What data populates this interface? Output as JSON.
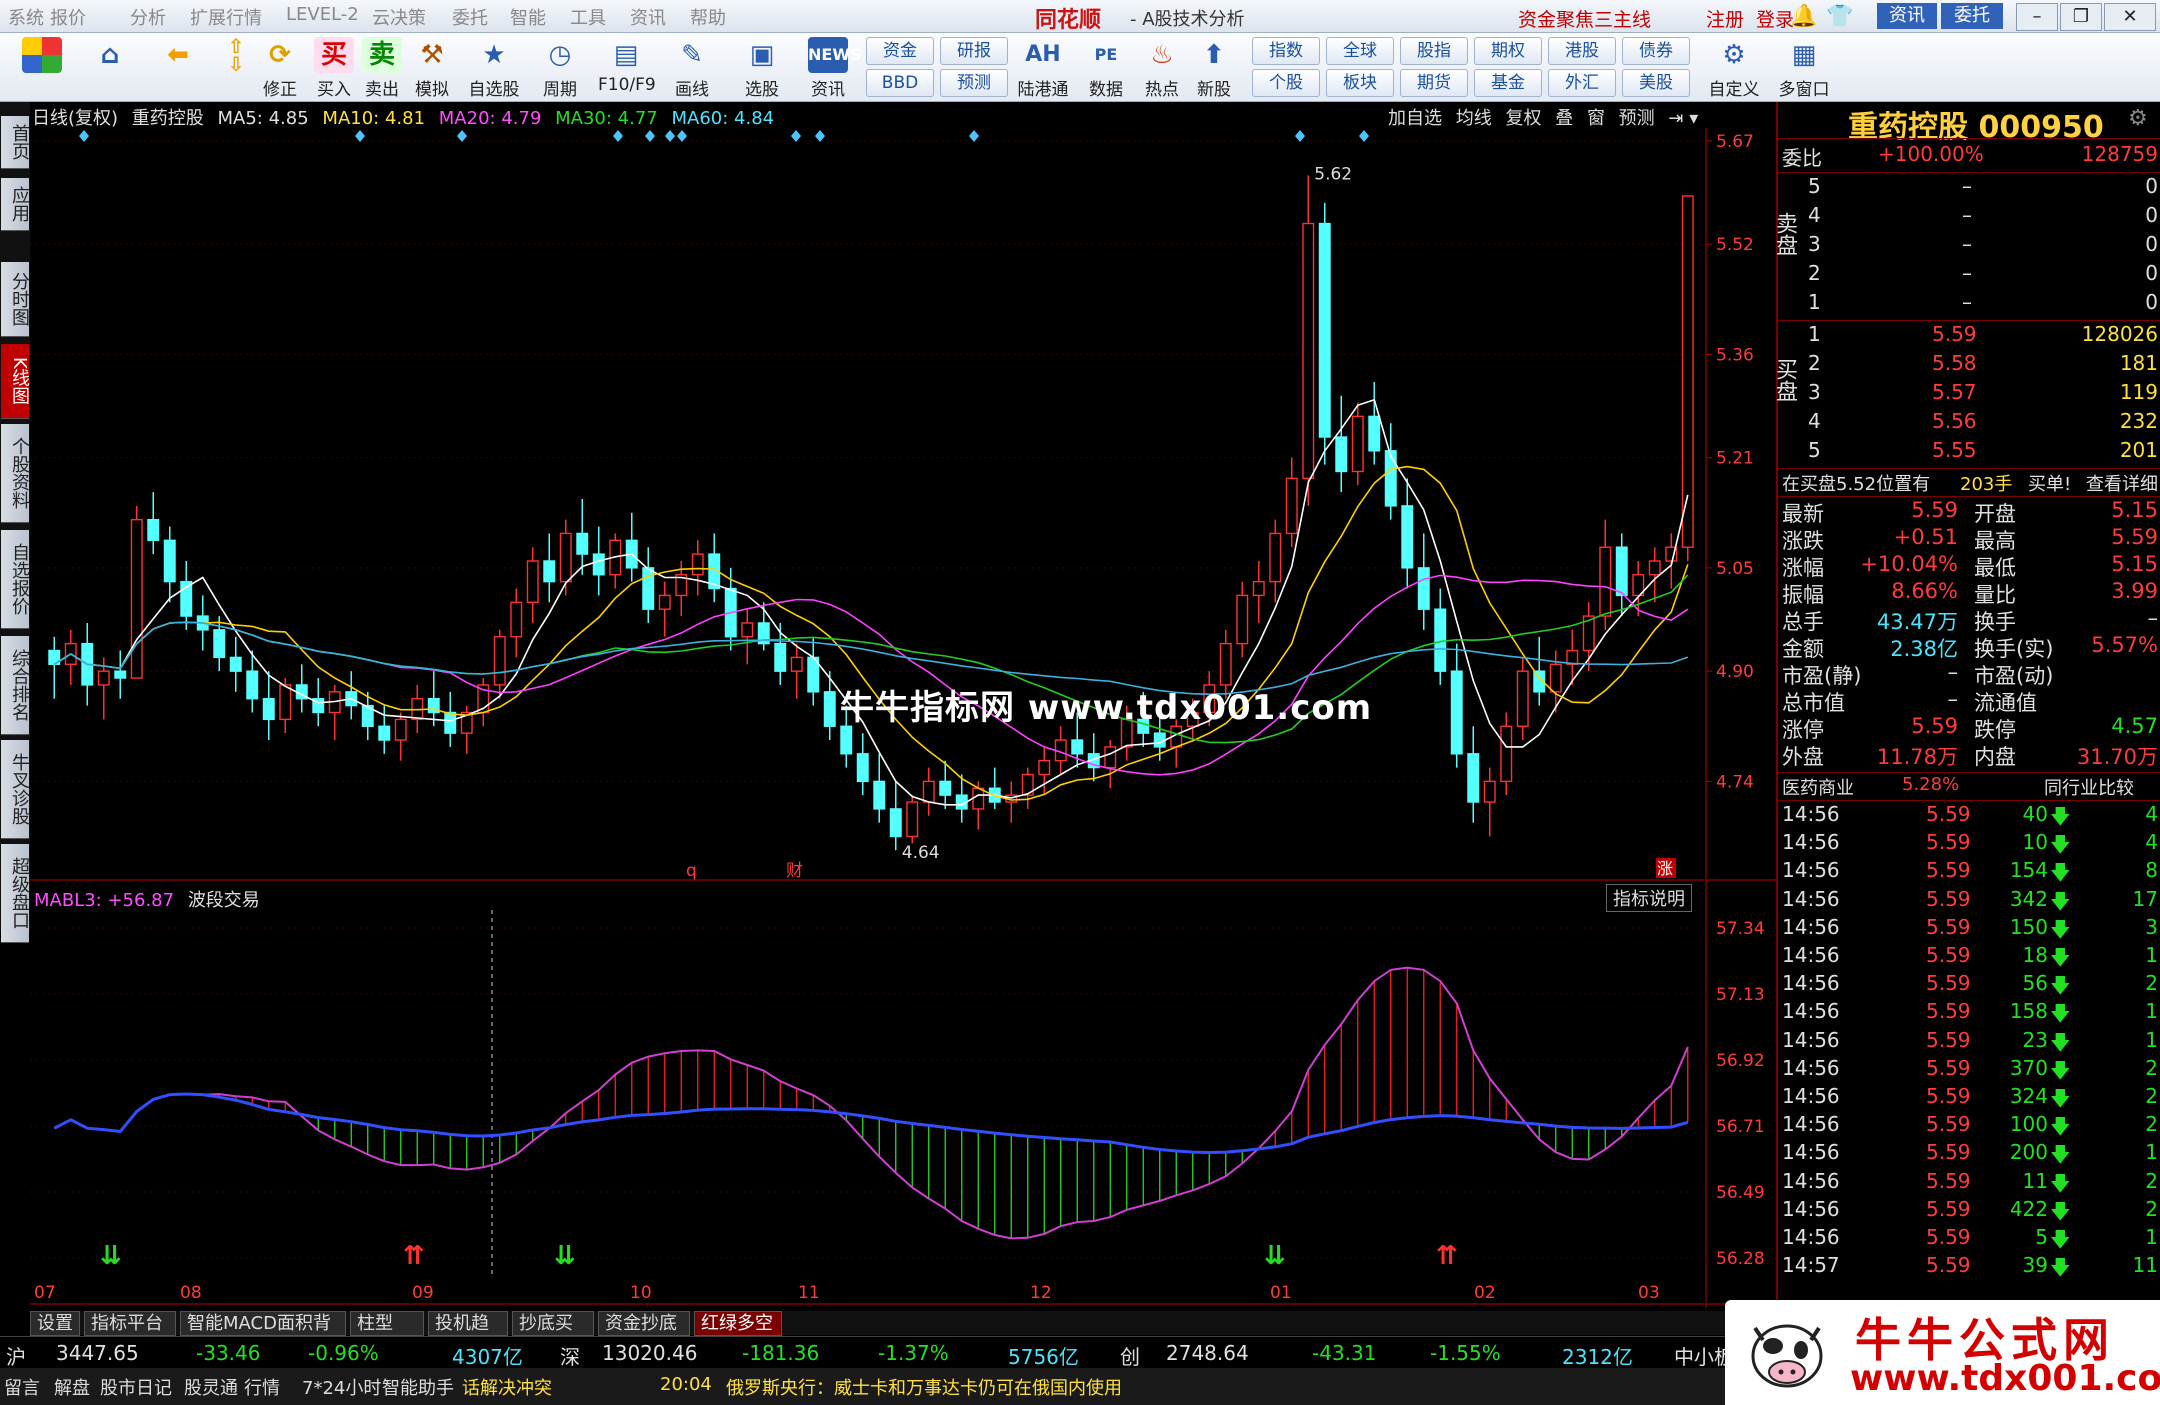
{
  "menu": [
    "系统",
    "报价",
    "分析",
    "扩展行情",
    "LEVEL-2",
    "云决策",
    "委托",
    "智能",
    "工具",
    "资讯",
    "帮助"
  ],
  "brand": "同花顺",
  "app_title": "- A股技术分析",
  "promo": "资金聚焦三主线",
  "register": "注册",
  "login": "登录",
  "news_btn": "资讯",
  "trade_btn": "委托",
  "toolbar": {
    "buttons": [
      "修正",
      "买入",
      "卖出",
      "模拟",
      "自选股",
      "周期",
      "F10/F9",
      "画线",
      "选股",
      "资讯",
      "陆港通",
      "数据",
      "热点",
      "新股",
      "自定义",
      "多窗口"
    ],
    "small": [
      "资金",
      "BBD",
      "研报",
      "预测",
      "指数",
      "个股",
      "全球",
      "板块",
      "股指",
      "期货",
      "期权",
      "基金",
      "港股",
      "外汇",
      "债券",
      "美股"
    ]
  },
  "left_tabs": [
    "首页",
    "应用",
    "分时图",
    "K线图",
    "个股资料",
    "自选报价",
    "综合排名",
    "牛叉诊股",
    "超级盘口"
  ],
  "chart_header": {
    "period": "日线(复权)",
    "name": "重药控股",
    "ma5": "MA5: 4.85",
    "ma10": "MA10: 4.81",
    "ma20": "MA20: 4.79",
    "ma30": "MA30: 4.77",
    "ma60": "MA60: 4.84",
    "tools": [
      "加自选",
      "均线",
      "复权",
      "叠",
      "窗",
      "预测"
    ]
  },
  "chart_data": {
    "type": "candlestick",
    "title": "重药控股 日线(复权)",
    "y_ticks": [
      "5.67",
      "5.52",
      "5.36",
      "5.21",
      "5.05",
      "4.90",
      "4.74"
    ],
    "ylim": [
      4.62,
      5.68
    ],
    "x_labels": [
      "07",
      "08",
      "09",
      "10",
      "11",
      "12",
      "01",
      "02",
      "03"
    ],
    "annotations": {
      "high": "5.62",
      "low": "4.64",
      "markers": [
        "q",
        "财",
        "涨"
      ]
    },
    "candles": [
      [
        4.93,
        4.95,
        4.86,
        4.91
      ],
      [
        4.91,
        4.96,
        4.88,
        4.94
      ],
      [
        4.94,
        4.97,
        4.85,
        4.88
      ],
      [
        4.88,
        4.92,
        4.83,
        4.9
      ],
      [
        4.9,
        4.93,
        4.86,
        4.89
      ],
      [
        4.89,
        5.14,
        4.89,
        5.12
      ],
      [
        5.12,
        5.16,
        5.07,
        5.09
      ],
      [
        5.09,
        5.11,
        5.0,
        5.03
      ],
      [
        5.03,
        5.06,
        4.96,
        4.98
      ],
      [
        4.98,
        5.01,
        4.93,
        4.96
      ],
      [
        4.96,
        4.98,
        4.9,
        4.92
      ],
      [
        4.92,
        4.95,
        4.87,
        4.9
      ],
      [
        4.9,
        4.93,
        4.84,
        4.86
      ],
      [
        4.86,
        4.9,
        4.8,
        4.83
      ],
      [
        4.83,
        4.89,
        4.81,
        4.88
      ],
      [
        4.88,
        4.91,
        4.84,
        4.86
      ],
      [
        4.86,
        4.89,
        4.82,
        4.84
      ],
      [
        4.84,
        4.88,
        4.8,
        4.87
      ],
      [
        4.87,
        4.9,
        4.83,
        4.85
      ],
      [
        4.85,
        4.87,
        4.8,
        4.82
      ],
      [
        4.82,
        4.85,
        4.78,
        4.8
      ],
      [
        4.8,
        4.84,
        4.77,
        4.83
      ],
      [
        4.83,
        4.88,
        4.81,
        4.86
      ],
      [
        4.86,
        4.9,
        4.82,
        4.84
      ],
      [
        4.84,
        4.87,
        4.79,
        4.81
      ],
      [
        4.81,
        4.85,
        4.78,
        4.84
      ],
      [
        4.84,
        4.89,
        4.82,
        4.88
      ],
      [
        4.88,
        4.96,
        4.86,
        4.95
      ],
      [
        4.95,
        5.02,
        4.92,
        5.0
      ],
      [
        5.0,
        5.08,
        4.97,
        5.06
      ],
      [
        5.06,
        5.1,
        5.0,
        5.03
      ],
      [
        5.03,
        5.12,
        5.01,
        5.1
      ],
      [
        5.1,
        5.15,
        5.04,
        5.07
      ],
      [
        5.07,
        5.11,
        5.01,
        5.04
      ],
      [
        5.04,
        5.1,
        5.02,
        5.09
      ],
      [
        5.09,
        5.13,
        5.03,
        5.05
      ],
      [
        5.05,
        5.08,
        4.97,
        4.99
      ],
      [
        4.99,
        5.03,
        4.95,
        5.01
      ],
      [
        5.01,
        5.06,
        4.98,
        5.04
      ],
      [
        5.04,
        5.09,
        5.01,
        5.07
      ],
      [
        5.07,
        5.1,
        5.0,
        5.02
      ],
      [
        5.02,
        5.05,
        4.93,
        4.95
      ],
      [
        4.95,
        4.99,
        4.91,
        4.97
      ],
      [
        4.97,
        5.0,
        4.93,
        4.94
      ],
      [
        4.94,
        4.97,
        4.88,
        4.9
      ],
      [
        4.9,
        4.94,
        4.86,
        4.92
      ],
      [
        4.92,
        4.95,
        4.85,
        4.87
      ],
      [
        4.87,
        4.9,
        4.8,
        4.82
      ],
      [
        4.82,
        4.85,
        4.76,
        4.78
      ],
      [
        4.78,
        4.81,
        4.72,
        4.74
      ],
      [
        4.74,
        4.78,
        4.68,
        4.7
      ],
      [
        4.7,
        4.74,
        4.64,
        4.66
      ],
      [
        4.66,
        4.72,
        4.65,
        4.71
      ],
      [
        4.71,
        4.76,
        4.69,
        4.74
      ],
      [
        4.74,
        4.77,
        4.7,
        4.72
      ],
      [
        4.72,
        4.75,
        4.68,
        4.7
      ],
      [
        4.7,
        4.74,
        4.67,
        4.73
      ],
      [
        4.73,
        4.76,
        4.7,
        4.71
      ],
      [
        4.71,
        4.74,
        4.68,
        4.72
      ],
      [
        4.72,
        4.76,
        4.7,
        4.75
      ],
      [
        4.75,
        4.79,
        4.72,
        4.77
      ],
      [
        4.77,
        4.82,
        4.75,
        4.8
      ],
      [
        4.8,
        4.84,
        4.76,
        4.78
      ],
      [
        4.78,
        4.81,
        4.74,
        4.76
      ],
      [
        4.76,
        4.8,
        4.73,
        4.79
      ],
      [
        4.79,
        4.85,
        4.77,
        4.83
      ],
      [
        4.83,
        4.87,
        4.79,
        4.81
      ],
      [
        4.81,
        4.84,
        4.77,
        4.79
      ],
      [
        4.79,
        4.83,
        4.76,
        4.82
      ],
      [
        4.82,
        4.86,
        4.8,
        4.84
      ],
      [
        4.84,
        4.9,
        4.82,
        4.88
      ],
      [
        4.88,
        4.96,
        4.86,
        4.94
      ],
      [
        4.94,
        5.03,
        4.92,
        5.01
      ],
      [
        5.01,
        5.06,
        4.97,
        5.03
      ],
      [
        5.03,
        5.12,
        5.0,
        5.1
      ],
      [
        5.1,
        5.21,
        5.08,
        5.18
      ],
      [
        5.18,
        5.62,
        5.14,
        5.55
      ],
      [
        5.55,
        5.58,
        5.2,
        5.24
      ],
      [
        5.24,
        5.3,
        5.16,
        5.19
      ],
      [
        5.19,
        5.29,
        5.17,
        5.27
      ],
      [
        5.27,
        5.32,
        5.2,
        5.22
      ],
      [
        5.22,
        5.26,
        5.12,
        5.14
      ],
      [
        5.14,
        5.18,
        5.02,
        5.05
      ],
      [
        5.05,
        5.1,
        4.96,
        4.99
      ],
      [
        4.99,
        5.02,
        4.88,
        4.9
      ],
      [
        4.9,
        4.94,
        4.76,
        4.78
      ],
      [
        4.78,
        4.82,
        4.68,
        4.71
      ],
      [
        4.71,
        4.76,
        4.66,
        4.74
      ],
      [
        4.74,
        4.84,
        4.72,
        4.82
      ],
      [
        4.82,
        4.92,
        4.8,
        4.9
      ],
      [
        4.9,
        4.95,
        4.85,
        4.87
      ],
      [
        4.87,
        4.93,
        4.84,
        4.91
      ],
      [
        4.91,
        4.96,
        4.88,
        4.93
      ],
      [
        4.93,
        5.0,
        4.9,
        4.98
      ],
      [
        4.98,
        5.12,
        4.96,
        5.08
      ],
      [
        5.08,
        5.1,
        4.98,
        5.01
      ],
      [
        5.01,
        5.06,
        4.98,
        5.04
      ],
      [
        5.04,
        5.08,
        5.0,
        5.06
      ],
      [
        5.06,
        5.1,
        5.02,
        5.08
      ],
      [
        5.08,
        5.59,
        5.06,
        5.59
      ]
    ],
    "ma_series": [
      {
        "name": "MA5",
        "color": "#ffffff"
      },
      {
        "name": "MA10",
        "color": "#ffd000"
      },
      {
        "name": "MA20",
        "color": "#ff40ff"
      },
      {
        "name": "MA30",
        "color": "#22cc22"
      },
      {
        "name": "MA60",
        "color": "#3ab0e0"
      }
    ]
  },
  "indicator": {
    "name": "MABL3: +56.87",
    "label": "波段交易",
    "help": "指标说明",
    "y_ticks": [
      "57.34",
      "57.13",
      "56.92",
      "56.71",
      "56.49",
      "56.28"
    ]
  },
  "indicator_tabs": [
    "设置",
    "指标平台",
    "智能MACD面积背离",
    "柱型KDJ",
    "投机趋势",
    "抄底买入",
    "资金抄底",
    "红绿多空"
  ],
  "right_panel": {
    "stock": "重药控股 000950",
    "weibi_label": "委比",
    "weibi": "+100.00%",
    "weicha": "128759",
    "sell_label": "卖盘",
    "sell": [
      [
        "5",
        "–",
        "0"
      ],
      [
        "4",
        "–",
        "0"
      ],
      [
        "3",
        "–",
        "0"
      ],
      [
        "2",
        "–",
        "0"
      ],
      [
        "1",
        "–",
        "0"
      ]
    ],
    "buy_label": "买盘",
    "buy": [
      [
        "1",
        "5.59",
        "128026"
      ],
      [
        "2",
        "5.58",
        "181"
      ],
      [
        "3",
        "5.57",
        "119"
      ],
      [
        "4",
        "5.56",
        "232"
      ],
      [
        "5",
        "5.55",
        "201"
      ]
    ],
    "notice": "在买盘5.52位置有",
    "notice_vol": "203手",
    "notice_tag": "买单!",
    "notice_link": "查看详细",
    "quote": [
      [
        "最新",
        "5.59",
        "开盘",
        "5.15"
      ],
      [
        "涨跌",
        "+0.51",
        "最高",
        "5.59"
      ],
      [
        "涨幅",
        "+10.04%",
        "最低",
        "5.15"
      ],
      [
        "振幅",
        "8.66%",
        "量比",
        "3.99"
      ],
      [
        "总手",
        "43.47万",
        "换手",
        "–"
      ],
      [
        "金额",
        "2.38亿",
        "换手(实)",
        "5.57%"
      ],
      [
        "市盈(静)",
        "–",
        "市盈(动)",
        ""
      ],
      [
        "总市值",
        "–",
        "流通值",
        ""
      ],
      [
        "涨停",
        "5.59",
        "跌停",
        "4.57"
      ],
      [
        "外盘",
        "11.78万",
        "内盘",
        "31.70万"
      ]
    ],
    "sector": "医药商业",
    "sector_pct": "5.28%",
    "sector_cmp": "同行业比较",
    "ticks": [
      [
        "14:56",
        "5.59",
        "40",
        "4"
      ],
      [
        "14:56",
        "5.59",
        "10",
        "4"
      ],
      [
        "14:56",
        "5.59",
        "154",
        "8"
      ],
      [
        "14:56",
        "5.59",
        "342",
        "17"
      ],
      [
        "14:56",
        "5.59",
        "150",
        "3"
      ],
      [
        "14:56",
        "5.59",
        "18",
        "1"
      ],
      [
        "14:56",
        "5.59",
        "56",
        "2"
      ],
      [
        "14:56",
        "5.59",
        "158",
        "1"
      ],
      [
        "14:56",
        "5.59",
        "23",
        "1"
      ],
      [
        "14:56",
        "5.59",
        "370",
        "2"
      ],
      [
        "14:56",
        "5.59",
        "324",
        "2"
      ],
      [
        "14:56",
        "5.59",
        "100",
        "2"
      ],
      [
        "14:56",
        "5.59",
        "200",
        "1"
      ],
      [
        "14:56",
        "5.59",
        "11",
        "2"
      ],
      [
        "14:56",
        "5.59",
        "422",
        "2"
      ],
      [
        "14:56",
        "5.59",
        "5",
        "1"
      ],
      [
        "14:57",
        "5.59",
        "39",
        "11"
      ]
    ]
  },
  "ticker": {
    "sh": [
      "沪",
      "3447.65",
      "-33.46",
      "-0.96%",
      "4307亿"
    ],
    "sz": [
      "深",
      "13020.46",
      "-181.36",
      "-1.37%",
      "5756亿"
    ],
    "cy": [
      "创",
      "2748.64",
      "-43.31",
      "-1.55%",
      "2312亿"
    ],
    "more": "中小板"
  },
  "status": {
    "items": [
      "留言",
      "解盘",
      "股市日记",
      "股灵通",
      "行情",
      "7*24小时",
      "智能助手"
    ],
    "headline": "话解决冲突",
    "news_time": "20:04",
    "news": "俄罗斯央行：威士卡和万事达卡仍可在俄国内使用"
  },
  "watermark": {
    "center": "牛牛指标网 www.tdx001.com",
    "corner_title": "牛牛公式网",
    "corner_url": "www.tdx001.com"
  }
}
